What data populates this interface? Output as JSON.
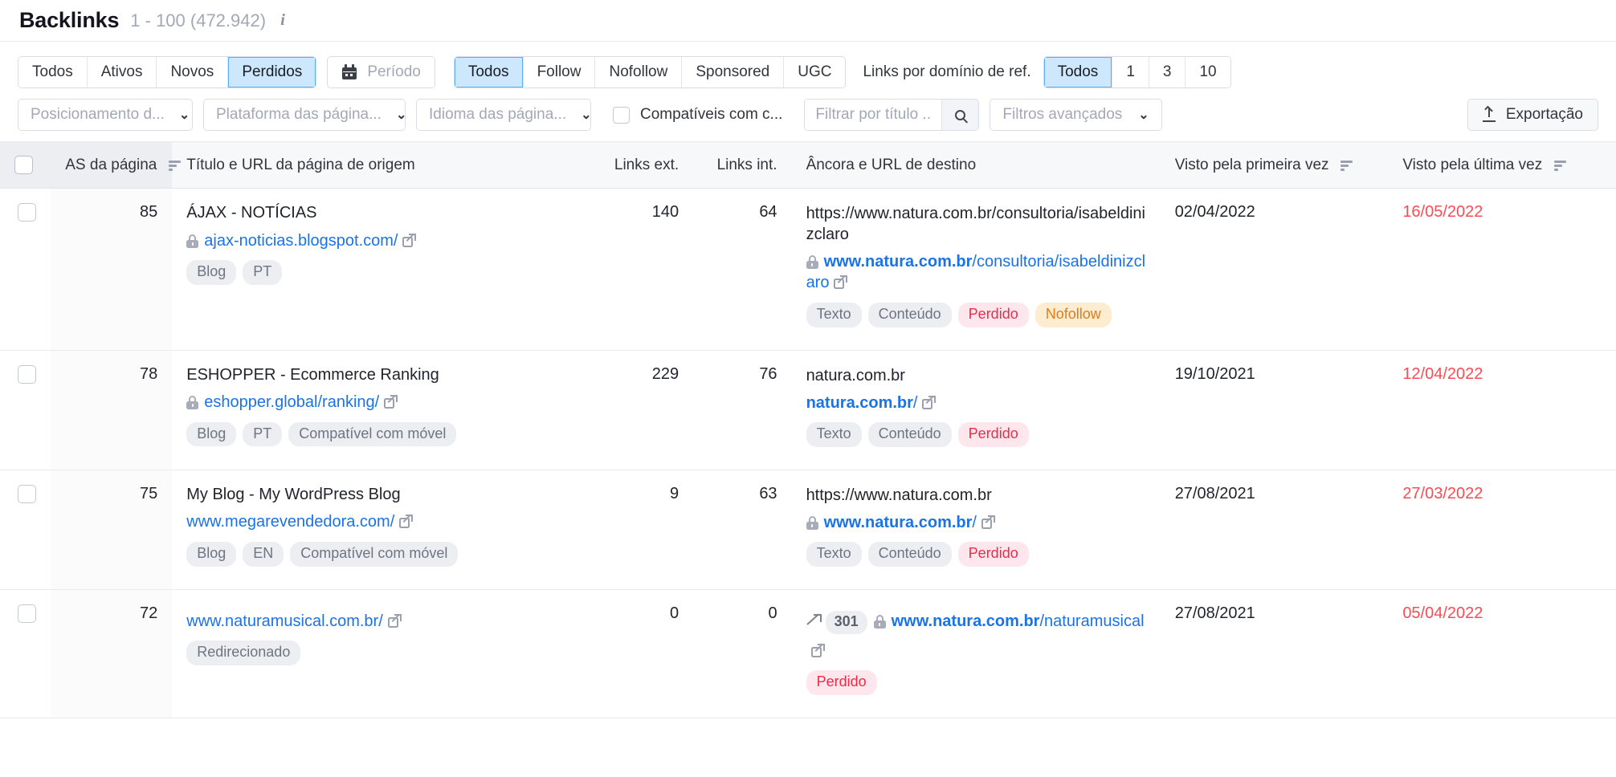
{
  "header": {
    "title": "Backlinks",
    "range": "1 - 100 (472.942)",
    "info_icon": "info-icon"
  },
  "toolbar": {
    "status_filters": [
      {
        "label": "Todos",
        "active": false
      },
      {
        "label": "Ativos",
        "active": false
      },
      {
        "label": "Novos",
        "active": false
      },
      {
        "label": "Perdidos",
        "active": true
      }
    ],
    "period_label": "Período",
    "follow_filters": [
      {
        "label": "Todos",
        "active": true
      },
      {
        "label": "Follow",
        "active": false
      },
      {
        "label": "Nofollow",
        "active": false
      },
      {
        "label": "Sponsored",
        "active": false
      },
      {
        "label": "UGC",
        "active": false
      }
    ],
    "links_per_domain_label": "Links por domínio de ref.",
    "links_per_domain": [
      {
        "label": "Todos",
        "active": true
      },
      {
        "label": "1",
        "active": false
      },
      {
        "label": "3",
        "active": false
      },
      {
        "label": "10",
        "active": false
      }
    ],
    "select_positioning": "Posicionamento d...",
    "select_platform": "Plataforma das página...",
    "select_language": "Idioma das página...",
    "mobile_checkbox_label": "Compatíveis com c...",
    "search_placeholder": "Filtrar por título ...",
    "advanced_filters": "Filtros avançados",
    "export_label": "Exportação",
    "caret": "⌄"
  },
  "table": {
    "columns": {
      "as": "AS da página",
      "title": "Título e URL da página de origem",
      "ext": "Links ext.",
      "int": "Links int.",
      "anchor": "Âncora e URL de destino",
      "first_seen": "Visto pela primeira vez",
      "last_seen": "Visto pela última vez"
    },
    "rows": [
      {
        "as": "85",
        "title": "ÁJAX - NOTÍCIAS",
        "source_url": "ajax-noticias.blogspot.com/",
        "source_secure": true,
        "source_tags": [
          "Blog",
          "PT"
        ],
        "ext": "140",
        "int": "64",
        "anchor_text": "https://www.natura.com.br/consultoria/isabeldinizclaro",
        "dest_url": "www.natura.com.br/consultoria/isabeldinizclaro",
        "dest_host": "www.natura.com.br",
        "dest_path": "/consultoria/isabeldinizclaro",
        "dest_secure": true,
        "redirect_code": "",
        "dest_tags": [
          "Texto",
          "Conteúdo",
          "Perdido",
          "Nofollow"
        ],
        "first_seen": "02/04/2022",
        "last_seen": "16/05/2022"
      },
      {
        "as": "78",
        "title": "ESHOPPER - Ecommerce Ranking",
        "source_url": "eshopper.global/ranking/",
        "source_secure": true,
        "source_tags": [
          "Blog",
          "PT",
          "Compatível com móvel"
        ],
        "ext": "229",
        "int": "76",
        "anchor_text": "natura.com.br",
        "dest_url": "natura.com.br/",
        "dest_host": "natura.com.br",
        "dest_path": "/",
        "dest_secure": false,
        "redirect_code": "",
        "dest_tags": [
          "Texto",
          "Conteúdo",
          "Perdido"
        ],
        "first_seen": "19/10/2021",
        "last_seen": "12/04/2022"
      },
      {
        "as": "75",
        "title": "My Blog - My WordPress Blog",
        "source_url": "www.megarevendedora.com/",
        "source_secure": false,
        "source_tags": [
          "Blog",
          "EN",
          "Compatível com móvel"
        ],
        "ext": "9",
        "int": "63",
        "anchor_text": "https://www.natura.com.br",
        "dest_url": "www.natura.com.br/",
        "dest_host": "www.natura.com.br",
        "dest_path": "/",
        "dest_secure": true,
        "redirect_code": "",
        "dest_tags": [
          "Texto",
          "Conteúdo",
          "Perdido"
        ],
        "first_seen": "27/08/2021",
        "last_seen": "27/03/2022"
      },
      {
        "as": "72",
        "title": "",
        "source_url": "www.naturamusical.com.br/",
        "source_secure": false,
        "source_tags": [
          "Redirecionado"
        ],
        "ext": "0",
        "int": "0",
        "anchor_text": "",
        "dest_url": "www.natura.com.br/naturamusical",
        "dest_host": "www.natura.com.br",
        "dest_path": "/naturamusical",
        "dest_secure": true,
        "redirect_code": "301",
        "dest_tags": [
          "Perdido"
        ],
        "first_seen": "27/08/2021",
        "last_seen": "05/04/2022"
      }
    ]
  },
  "colors": {
    "accent": "#1a73e8",
    "active_bg": "#cde7fd",
    "active_border": "#5bb0f5",
    "lost_text": "#fb4b54",
    "lost_tag_bg": "#fde7ec",
    "lost_tag_text": "#f0294a",
    "nofollow_bg": "#fcecd0",
    "nofollow_text": "#e07c1c"
  }
}
